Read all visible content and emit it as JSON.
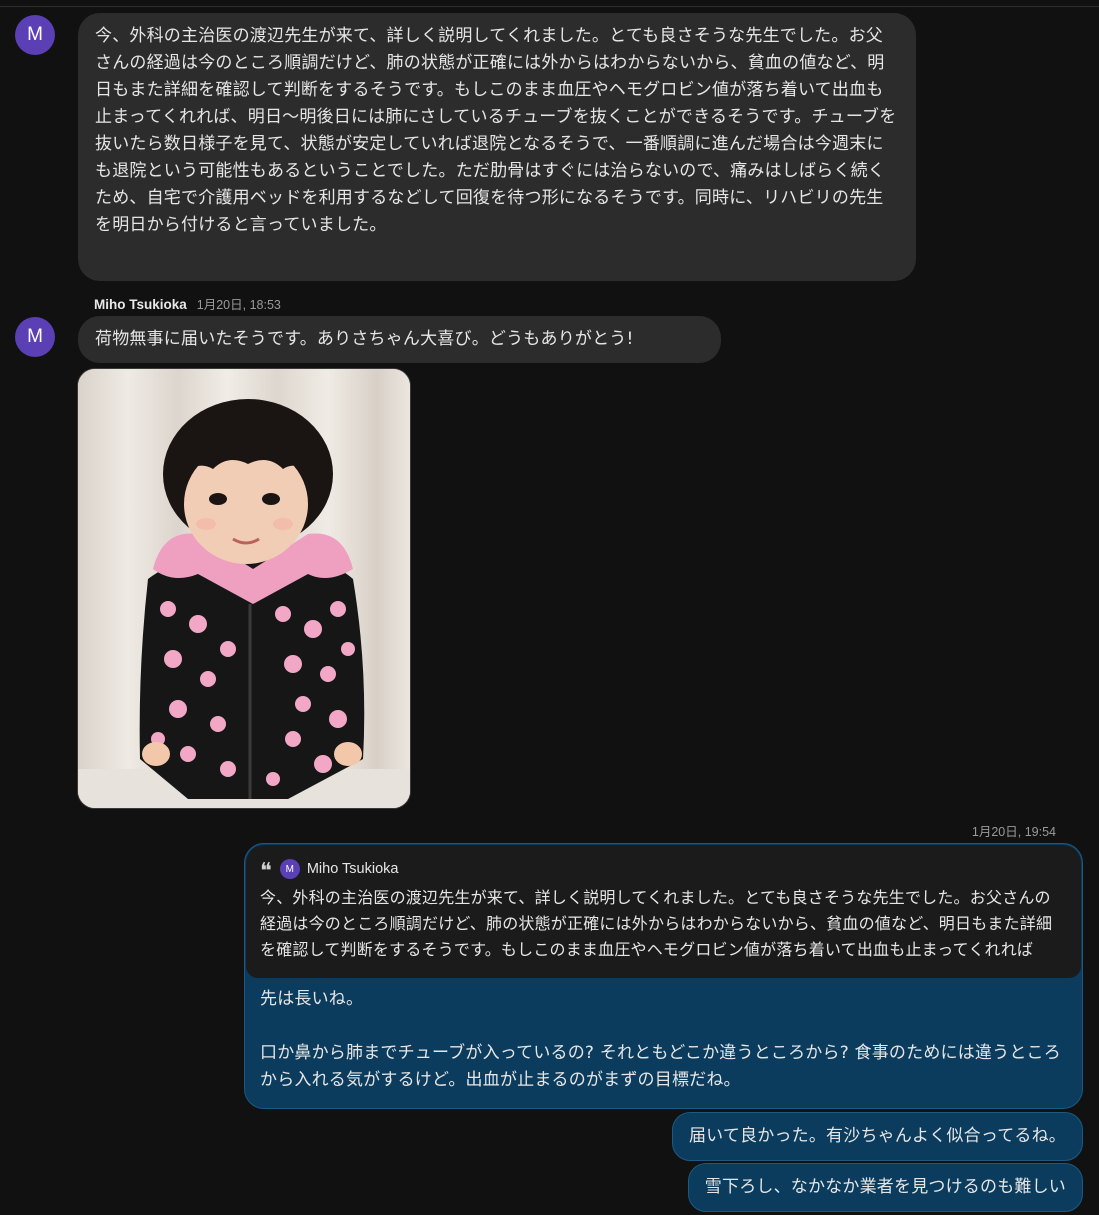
{
  "messages": {
    "first": {
      "avatar_letter": "M",
      "text": "今、外科の主治医の渡辺先生が来て、詳しく説明してくれました。とても良さそうな先生でした。お父さんの経過は今のところ順調だけど、肺の状態が正確には外からはわからないから、貧血の値など、明日もまた詳細を確認して判断をするそうです。もしこのまま血圧やヘモグロビン値が落ち着いて出血も止まってくれれば、明日〜明後日には肺にさしているチューブを抜くことができるそうです。チューブを抜いたら数日様子を見て、状態が安定していれば退院となるそうで、一番順調に進んだ場合は今週末にも退院という可能性もあるということでした。ただ肋骨はすぐには治らないので、痛みはしばらく続くため、自宅で介護用ベッドを利用するなどして回復を待つ形になるそうです。同時に、リハビリの先生を明日から付けると言っていました。"
    },
    "second": {
      "sender": "Miho Tsukioka",
      "timestamp": "1月20日, 18:53",
      "avatar_letter": "M",
      "text": "荷物無事に届いたそうです。ありさちゃん大喜び。どうもありがとう!"
    },
    "reply": {
      "timestamp": "1月20日, 19:54",
      "quote_sender": "Miho Tsukioka",
      "quote_avatar_letter": "M",
      "quote_mark": "❝",
      "quote_text": "今、外科の主治医の渡辺先生が来て、詳しく説明してくれました。とても良さそうな先生でした。お父さんの経過は今のところ順調だけど、肺の状態が正確には外からはわからないから、貧血の値など、明日もまた詳細を確認して判断をするそうです。もしこのまま血圧やヘモグロビン値が落ち着いて出血も止まってくれれば",
      "text": "先は長いね。\n\n口か鼻から肺までチューブが入っているの? それともどこか違うところから? 食事のためには違うところから入れる気がするけど。出血が止まるのがまずの目標だね。"
    },
    "outgoing_1": {
      "text": "届いて良かった。有沙ちゃんよく似合ってるね。"
    },
    "outgoing_2": {
      "text": "雪下ろし、なかなか業者を見つけるのも難しい"
    }
  },
  "colors": {
    "background": "#111111",
    "incoming_bubble": "#2c2c2c",
    "outgoing_bubble": "#0b3c5d",
    "avatar": "#5b3fb5"
  }
}
